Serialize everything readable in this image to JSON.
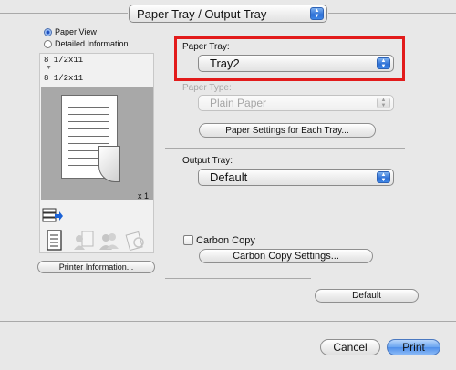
{
  "panel_menu": {
    "selected": "Paper Tray / Output Tray"
  },
  "view_mode": {
    "options": [
      {
        "label": "Paper View",
        "selected": true
      },
      {
        "label": "Detailed Information",
        "selected": false
      }
    ]
  },
  "preview": {
    "paper_size_top": "8 1/2x11",
    "paper_size_bottom": "8 1/2x11",
    "copies": "x 1"
  },
  "printer_info_button": "Printer Information...",
  "paper_tray": {
    "label": "Paper Tray:",
    "value": "Tray2"
  },
  "paper_type": {
    "label": "Paper Type:",
    "value": "Plain Paper",
    "enabled": false
  },
  "paper_settings_button": "Paper Settings for Each Tray...",
  "output_tray": {
    "label": "Output Tray:",
    "value": "Default"
  },
  "carbon_copy": {
    "label": "Carbon Copy",
    "checked": false
  },
  "carbon_copy_settings_button": "Carbon Copy Settings...",
  "default_button": "Default",
  "cancel_button": "Cancel",
  "print_button": "Print",
  "colors": {
    "highlight": "#e21b1b",
    "accent": "#4f8fea"
  }
}
